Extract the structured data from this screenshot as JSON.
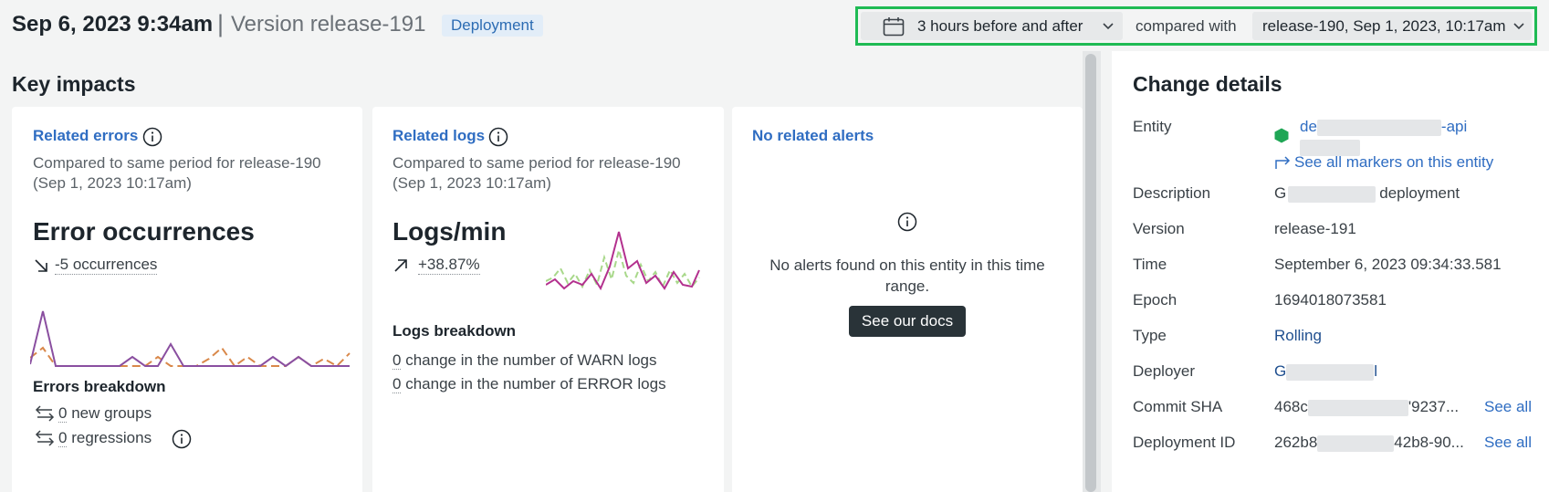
{
  "header": {
    "date": "Sep 6, 2023 9:34am",
    "separator": "|",
    "version": "Version release-191",
    "badge": "Deployment"
  },
  "compare": {
    "time_range": "3 hours before and after",
    "compared_with_label": "compared with",
    "compared_release": "release-190, Sep 1, 2023, 10:17am"
  },
  "key_impacts": {
    "title": "Key impacts",
    "errors_card": {
      "link": "Related errors",
      "subtitle": "Compared to same period for release-190 (Sep 1, 2023 10:17am)",
      "metric_title": "Error occurrences",
      "trend": "-5 occurrences",
      "breakdown_title": "Errors breakdown",
      "new_groups_count": "0",
      "new_groups_label": "new groups",
      "regressions_count": "0",
      "regressions_label": "regressions"
    },
    "logs_card": {
      "link": "Related logs",
      "subtitle": "Compared to same period for release-190 (Sep 1, 2023 10:17am)",
      "metric_title": "Logs/min",
      "trend": "+38.87%",
      "breakdown_title": "Logs breakdown",
      "warn_count": "0",
      "warn_label": "change in the number of WARN logs",
      "error_count": "0",
      "error_label": "change in the number of ERROR logs"
    },
    "alerts_card": {
      "link": "No related alerts",
      "message": "No alerts found on this entity in this time range.",
      "docs_button": "See our docs"
    }
  },
  "change_details": {
    "title": "Change details",
    "entity_label": "Entity",
    "entity_prefix": "de",
    "entity_suffix": "-api",
    "see_markers": "See all markers on this entity",
    "description_label": "Description",
    "description_prefix": "G",
    "description_suffix": "deployment",
    "version_label": "Version",
    "version_value": "release-191",
    "time_label": "Time",
    "time_value": "September 6, 2023 09:34:33.581",
    "epoch_label": "Epoch",
    "epoch_value": "1694018073581",
    "type_label": "Type",
    "type_value": "Rolling",
    "deployer_label": "Deployer",
    "deployer_prefix": "G",
    "deployer_suffix": "l",
    "commit_label": "Commit SHA",
    "commit_prefix": "468c",
    "commit_suffix": "'9237...",
    "deployment_id_label": "Deployment ID",
    "deployment_id_prefix": "262b8",
    "deployment_id_suffix": "42b8-90...",
    "see_all": "See all"
  },
  "colors": {
    "accent_green": "#1fbb54",
    "link_blue": "#2f6dc2",
    "series_purple": "#8a4fa0",
    "series_orange": "#d9884a",
    "series_magenta": "#b3318e",
    "series_lightgreen": "#a8d88a"
  },
  "icons": {
    "calendar": "calendar-icon",
    "chevron": "chevron-down-icon",
    "info": "info-icon",
    "trend_down": "arrow-down-right-icon",
    "trend_up": "arrow-up-right-icon",
    "swap": "swap-arrows-icon",
    "entity": "hexagon-icon",
    "external": "share-arrow-icon"
  }
}
